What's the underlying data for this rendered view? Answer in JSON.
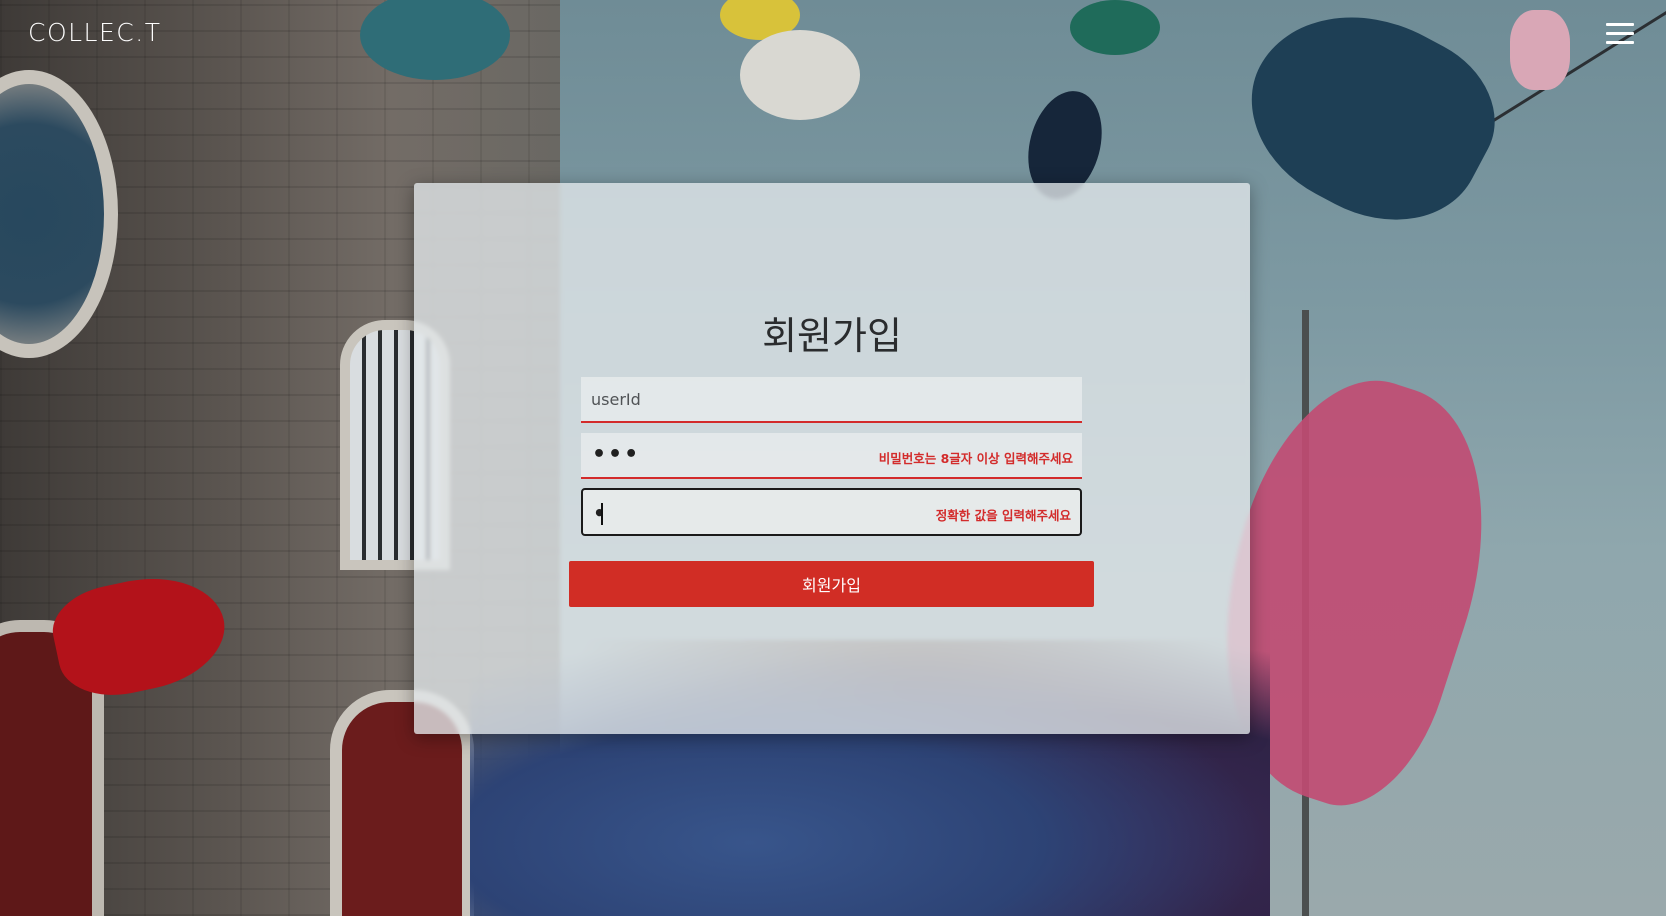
{
  "header": {
    "logo_text": "COLLEC.T",
    "menu_icon": "hamburger-menu-icon"
  },
  "signup": {
    "title": "회원가입",
    "userid": {
      "placeholder": "userId",
      "value": ""
    },
    "password": {
      "masked_value": "•••",
      "error": "비밀번호는 8글자 이상 입력해주세요"
    },
    "password_confirm": {
      "masked_value": "•",
      "error": "정확한 값을 입력해주세요"
    },
    "submit_label": "회원가입"
  },
  "colors": {
    "accent": "#d12d25",
    "error": "#d32b2b",
    "card_bg": "#e3e8ea"
  }
}
